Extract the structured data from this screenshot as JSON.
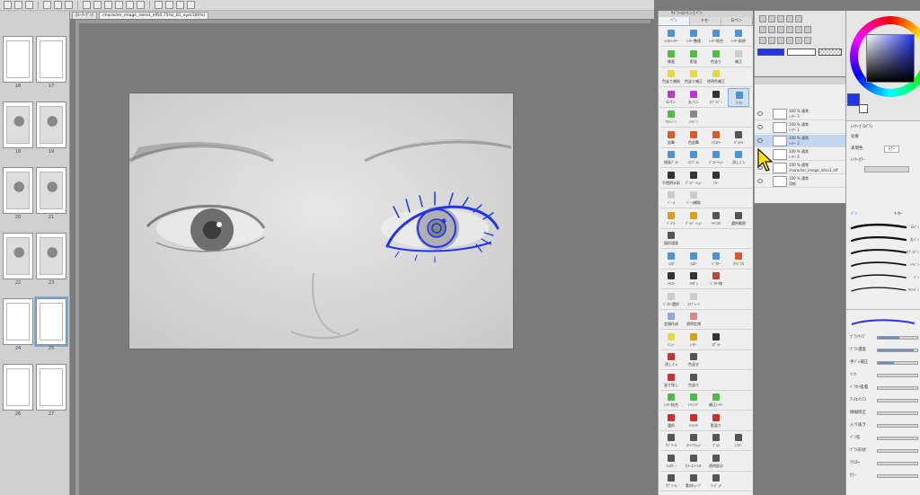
{
  "toolbar": {
    "buttons": [
      "new-icon",
      "open-icon",
      "save-icon",
      "undo-icon",
      "redo-icon",
      "clear-icon",
      "transform-icon",
      "crop-icon",
      "fill-icon",
      "select-icon",
      "lasso-icon",
      "ruler-icon",
      "zoom-icon",
      "hand-icon",
      "color-icon",
      "brush-icon"
    ]
  },
  "doc_tabs": [
    {
      "label": "ｽﾄｰﾘｰﾌﾞｯｸ"
    },
    {
      "label": "character_image_intro3_eff(0.75%)_01_eye(100%)"
    }
  ],
  "page_strip": {
    "pages": [
      {
        "num": "16"
      },
      {
        "num": "17"
      },
      {
        "num": "18"
      },
      {
        "num": "19"
      },
      {
        "num": "20"
      },
      {
        "num": "21"
      },
      {
        "num": "22"
      },
      {
        "num": "23"
      },
      {
        "num": "24"
      },
      {
        "num": "25"
      },
      {
        "num": "26"
      },
      {
        "num": "27"
      }
    ]
  },
  "subtool": {
    "title": "ｻﾌﾞﾂｰﾙ[ペン] ﾍﾟﾝ",
    "tabs": [
      "ﾍﾟﾝ",
      "ﾏｰｶｰ",
      "Gペン"
    ],
    "rows": [
      {
        "items": [
          {
            "label": "ｲﾗｽﾄﾚｲﾔｰ",
            "color": "#4b92d6"
          },
          {
            "label": "ﾚｲﾔｰ整理",
            "color": "#4b92d6"
          },
          {
            "label": "ﾚｲﾔｰ結合",
            "color": "#4b92d6"
          },
          {
            "label": "ﾚｲﾔｰ削除",
            "color": "#4b92d6"
          }
        ]
      },
      {
        "items": [
          {
            "label": "線画",
            "color": "#55b84b"
          },
          {
            "label": "影塗",
            "color": "#55b84b"
          },
          {
            "label": "色塗り",
            "color": "#55b84b"
          },
          {
            "label": "補正",
            "color": "#cccccc"
          }
        ]
      },
      {
        "items": [
          {
            "label": "色塗り補助",
            "color": "#e6d84a"
          },
          {
            "label": "色塗り補正",
            "color": "#e6d84a"
          },
          {
            "label": "透明色補正",
            "color": "#e6d84a"
          }
        ]
      },
      {
        "items": [
          {
            "label": "Gペン",
            "color": "#b43cc8"
          },
          {
            "label": "丸ペン",
            "color": "#b43cc8"
          },
          {
            "label": "ｶﾌﾞﾗﾍﾟﾝ",
            "color": "#333333"
          },
          {
            "label": "ﾏｰｶｰ",
            "color": "#4b92d6"
          }
        ]
      },
      {
        "items": [
          {
            "label": "ｻｲﾝﾍﾟﾝ",
            "color": "#55b84b"
          },
          {
            "label": "ﾐﾘﾍﾟﾝ",
            "color": "#888888"
          }
        ]
      },
      {
        "items": [
          {
            "label": "鉛筆",
            "color": "#d95a2b"
          },
          {
            "label": "色鉛筆",
            "color": "#d95a2b"
          },
          {
            "label": "ﾃｸｽﾁｬ",
            "color": "#d95a2b"
          },
          {
            "label": "ﾊﾟｽﾃﾙ",
            "color": "#555555"
          }
        ]
      },
      {
        "items": [
          {
            "label": "描画ﾌﾞﾗｼ",
            "color": "#4b92d6"
          },
          {
            "label": "ｴｱﾌﾞﾗｼ",
            "color": "#4b92d6"
          },
          {
            "label": "ﾃﾞｺﾚｰｼｮﾝ",
            "color": "#4b92d6"
          },
          {
            "label": "消しｺﾞﾑ",
            "color": "#4b92d6"
          }
        ]
      },
      {
        "items": [
          {
            "label": "不透明水彩",
            "color": "#333333"
          },
          {
            "label": "ｸﾞﾗﾃﾞｰｼｮﾝ",
            "color": "#333333"
          },
          {
            "label": "ﾚﾀｰ",
            "color": "#333333"
          }
        ]
      },
      {
        "items": [
          {
            "label": "ﾍﾞｰｽ",
            "color": "#cccccc"
          },
          {
            "label": "ﾍﾞｰｽ補助",
            "color": "#cccccc"
          }
        ]
      },
      {
        "items": [
          {
            "label": "ﾍﾟｲﾝﾄ",
            "color": "#d8a020"
          },
          {
            "label": "ｸﾞﾗﾃﾞｰｼｮﾝ",
            "color": "#d8a020"
          },
          {
            "label": "ﾁｬﾝﾈﾙ",
            "color": "#555555"
          },
          {
            "label": "選択範囲",
            "color": "#555555"
          }
        ]
      },
      {
        "items": [
          {
            "label": "図形描画",
            "color": "#555555"
          }
        ]
      },
      {
        "items": [
          {
            "label": "ﾗｽﾀ",
            "color": "#4b92d6"
          },
          {
            "label": "ﾗｽﾀｰ",
            "color": "#4b92d6"
          },
          {
            "label": "ﾍﾞｸﾀｰ",
            "color": "#4b92d6"
          },
          {
            "label": "ｵﾘｼﾞﾅﾙ",
            "color": "#d95a2b"
          }
        ]
      },
      {
        "items": [
          {
            "label": "ﾃｷｽﾄ",
            "color": "#333333"
          },
          {
            "label": "ﾌｷﾀﾞｼ",
            "color": "#333333"
          },
          {
            "label": "ﾍﾞｸﾀｰ線",
            "color": "#b84a3a"
          }
        ]
      },
      {
        "items": [
          {
            "label": "ﾍﾞｸﾀｰ選択",
            "color": "#cccccc"
          },
          {
            "label": "ｺﾏﾌﾞﾚｰﾄ",
            "color": "#cccccc"
          }
        ]
      },
      {
        "items": [
          {
            "label": "定規作成",
            "color": "#9aa4d8"
          },
          {
            "label": "透明定規",
            "color": "#d88"
          }
        ]
      },
      {
        "items": [
          {
            "label": "ﾒﾆｭｰ",
            "color": "#e6d84a"
          },
          {
            "label": "ﾚｲﾔｰ",
            "color": "#d8a020"
          },
          {
            "label": "ｽﾎﾟｲﾄ",
            "color": "#333333"
          }
        ]
      },
      {
        "items": [
          {
            "label": "消しｺﾞﾑ",
            "color": "#c83232"
          },
          {
            "label": "色混ぜ",
            "color": "#555555"
          }
        ]
      },
      {
        "items": [
          {
            "label": "塗り残し",
            "color": "#c83232"
          },
          {
            "label": "色塗り",
            "color": "#555555"
          }
        ]
      },
      {
        "items": [
          {
            "label": "ﾚｲﾔｰ結合",
            "color": "#55b84b"
          },
          {
            "label": "ﾄﾘﾐﾝｸﾞ",
            "color": "#55b84b"
          },
          {
            "label": "補正ﾚｲﾔｰ",
            "color": "#55b84b"
          }
        ]
      },
      {
        "items": [
          {
            "label": "選択",
            "color": "#c83232"
          },
          {
            "label": "ﾊｲﾗｲﾄ",
            "color": "#c83232"
          },
          {
            "label": "影塗り",
            "color": "#c83232"
          }
        ]
      },
      {
        "items": [
          {
            "label": "ｻﾌﾞﾂｰﾙ",
            "color": "#555555"
          },
          {
            "label": "ｵｰﾄｱｸｼｮﾝ",
            "color": "#555555"
          },
          {
            "label": "ﾌﾞﾗｼ",
            "color": "#555555"
          },
          {
            "label": "ﾚｲﾔｰ",
            "color": "#555555"
          }
        ]
      },
      {
        "items": [
          {
            "label": "ﾌｫﾙﾀﾞｰ",
            "color": "#555555"
          },
          {
            "label": "ｶﾗｰｺﾝﾄﾗｽﾄ",
            "color": "#555555"
          },
          {
            "label": "透明部分",
            "color": "#555555"
          }
        ]
      },
      {
        "items": [
          {
            "label": "ｻﾌﾞﾂｰﾙ",
            "color": "#555555"
          },
          {
            "label": "素材ｼｪｰﾌﾟ",
            "color": "#555555"
          },
          {
            "label": "ﾌｨｷﾞｭｱ",
            "color": "#555555"
          }
        ]
      }
    ]
  },
  "layers": [
    {
      "name": "100 % 通常",
      "sub": "ﾚｲﾔｰ 3",
      "selected": false
    },
    {
      "name": "100 % 通常",
      "sub": "ﾚｲﾔｰ 1",
      "selected": false
    },
    {
      "name": "100 % 通常",
      "sub": "ﾚｲﾔｰ 2",
      "selected": true
    },
    {
      "name": "100 % 通常",
      "sub": "ﾚｲﾔｰ 4",
      "selected": false
    },
    {
      "name": "100 % 通常",
      "sub": "character_image_intro3_eff",
      "selected": false
    },
    {
      "name": "100 % 通常",
      "sub": "用紙",
      "selected": false
    }
  ],
  "brush": {
    "tabs": [
      "ﾍﾟﾝ",
      "ﾏｰｶｰ"
    ],
    "labels": [
      "Gﾍﾟﾝ",
      "丸ﾍﾟﾝ",
      "ｶﾌﾞﾗﾍﾟﾝ",
      "ﾐﾘﾍﾟﾝ",
      "ﾍﾟﾝ",
      "ｻｲﾝﾍﾟﾝ"
    ]
  },
  "property": {
    "title": "ﾚｲﾔｰﾌﾟﾛﾊﾟﾃｨ",
    "effect_label": "効果",
    "expression_label": "表現色",
    "expression_value": "ｶﾗｰ",
    "border_label": "ﾚｲﾔｰｶﾗｰ"
  },
  "toolprop": {
    "rows": [
      {
        "label": "ﾌﾞﾗｼｻｲｽﾞ",
        "fill": 0.55
      },
      {
        "label": "ﾌﾞﾗｼ濃度",
        "fill": 0.9
      },
      {
        "label": "手ﾌﾞﾚ補正",
        "fill": 0.4
      },
      {
        "label": "ｲﾝｸ",
        "fill": 0.0
      },
      {
        "label": "ﾍﾞｸﾀｰ吸着",
        "fill": 0.0
      },
      {
        "label": "ｱﾝﾁｴｲﾘｱｽ",
        "fill": 0.0
      },
      {
        "label": "線幅修正",
        "fill": 0.0
      },
      {
        "label": "入り抜き",
        "fill": 0.0
      },
      {
        "label": "ﾍﾟﾝ先",
        "fill": 0.0
      },
      {
        "label": "ﾌﾞﾗｼ形状",
        "fill": 0.0
      },
      {
        "label": "ﾃｸｽﾁｬ",
        "fill": 0.0
      },
      {
        "label": "ｶﾗｰ",
        "fill": 0.0
      }
    ]
  },
  "colors": {
    "main": "#2233ee",
    "sub": "#ffffff",
    "accent": "#86a9d6",
    "drawing": "#2233ee"
  },
  "eye": {
    "rx": 0.5,
    "ry": 0.5
  }
}
